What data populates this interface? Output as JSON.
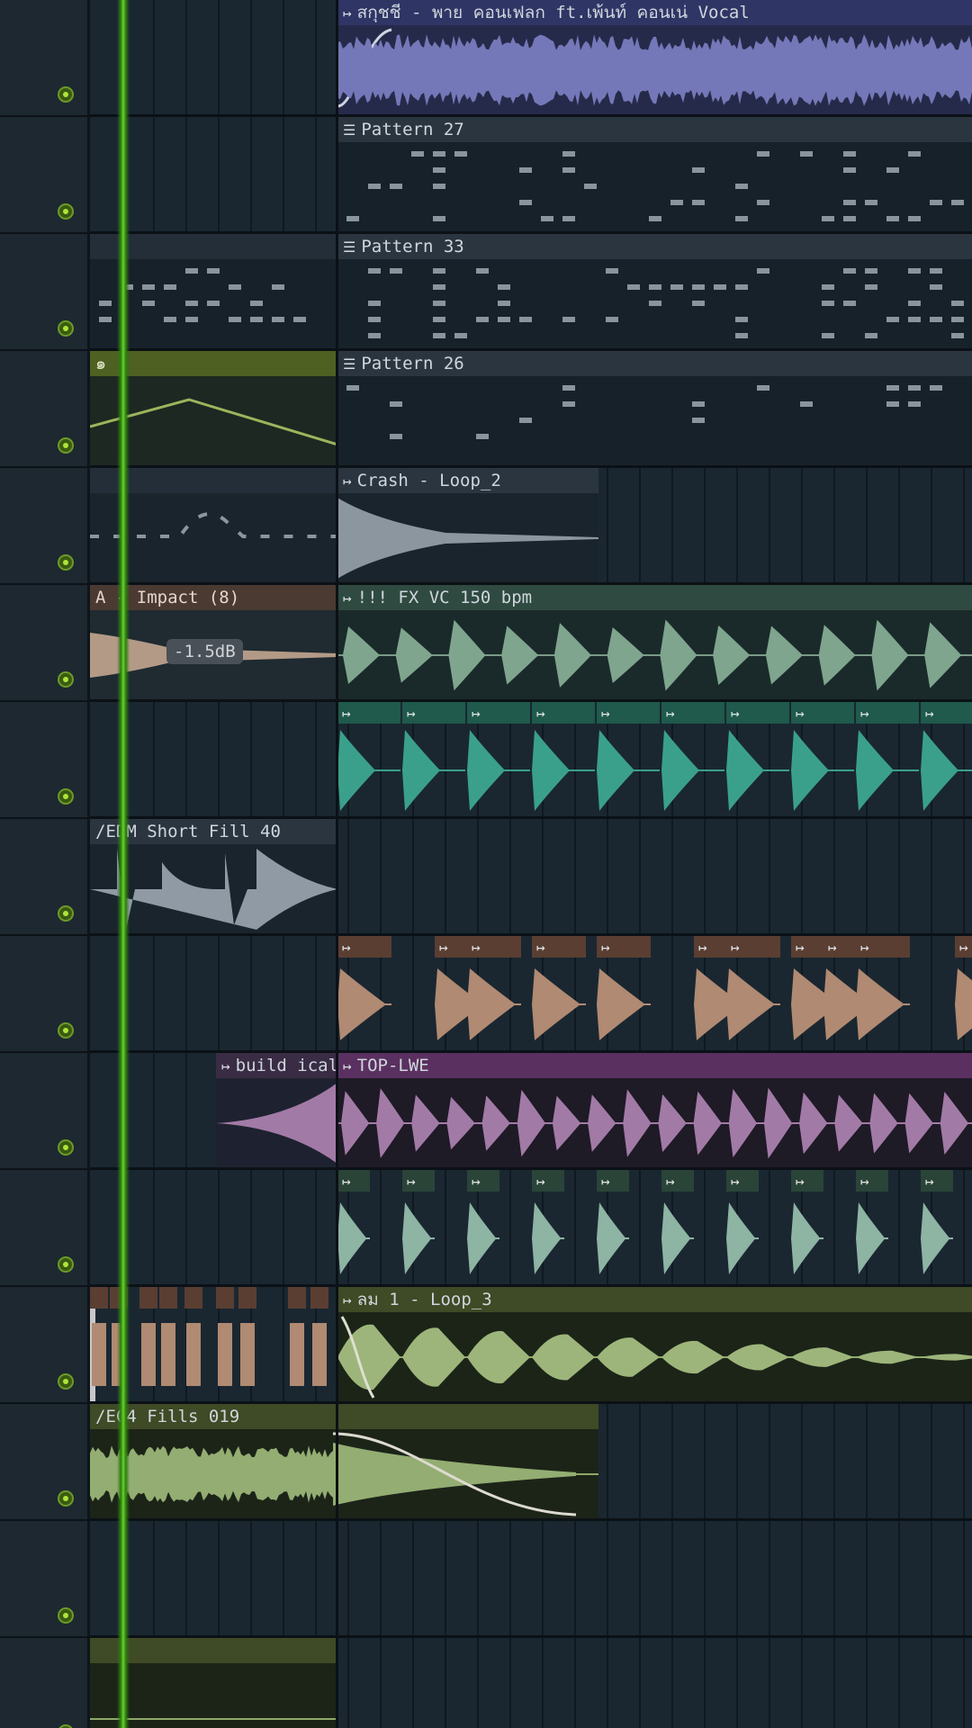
{
  "colors": {
    "background": "#14202a",
    "lane_bg": "#1a2731",
    "led": "#aee43a",
    "playhead": "#66d42a",
    "vocal": "#6c6fa8",
    "pattern": "#2b3540",
    "crash": "#8e99a2",
    "fx": "#7aa08a",
    "teal": "#3aa08c",
    "brown": "#b08a72",
    "purple": "#a27aa6",
    "green": "#8da86a"
  },
  "tracks": [
    {
      "clips": [
        {
          "id": "vocal",
          "label": "สกุชชี - พาย คอนเฟลก ft.เพ้นท์ คอนเน่ Vocal",
          "icon": "audio-clip-icon"
        }
      ]
    },
    {
      "clips": [
        {
          "id": "p27",
          "label": "Pattern 27",
          "icon": "pattern-icon"
        }
      ]
    },
    {
      "clips": [
        {
          "id": "p33",
          "label": "Pattern 33",
          "icon": "pattern-icon"
        }
      ]
    },
    {
      "clips": [
        {
          "id": "auto",
          "label": "๑",
          "icon": ""
        },
        {
          "id": "p26",
          "label": "Pattern 26",
          "icon": "pattern-icon"
        }
      ]
    },
    {
      "clips": [
        {
          "id": "crash",
          "label": "Crash - Loop_2",
          "icon": "audio-clip-icon"
        }
      ]
    },
    {
      "clips": [
        {
          "id": "impact",
          "label": "A - Impact (8)",
          "icon": ""
        },
        {
          "id": "fxvc",
          "label": "!!! FX VC 150 bpm",
          "icon": "audio-clip-icon"
        }
      ]
    },
    {
      "clips": []
    },
    {
      "clips": [
        {
          "id": "edm",
          "label": "/EDM Short Fill 40",
          "icon": ""
        }
      ]
    },
    {
      "clips": []
    },
    {
      "clips": [
        {
          "id": "build",
          "label": "build ical",
          "icon": "audio-clip-icon"
        },
        {
          "id": "top",
          "label": "TOP-LWE",
          "icon": "audio-clip-icon"
        }
      ]
    },
    {
      "clips": []
    },
    {
      "clips": [
        {
          "id": "lom",
          "label": "ลม 1 - Loop_3",
          "icon": "audio-clip-icon"
        }
      ]
    },
    {
      "clips": [
        {
          "id": "ec4",
          "label": "/EC4 Fills 019",
          "icon": ""
        }
      ]
    },
    {
      "clips": []
    },
    {
      "clips": []
    }
  ],
  "gain_label": "-1.5dB"
}
